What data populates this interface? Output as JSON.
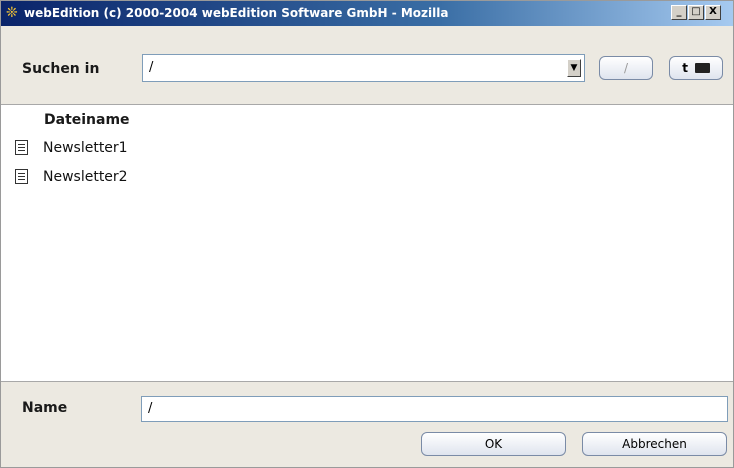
{
  "window": {
    "title": "webEdition (c) 2000-2004 webEdition Software GmbH - Mozilla",
    "app_icon": "webedition-icon",
    "controls": {
      "minimize": "_",
      "maximize": "□",
      "close": "X"
    }
  },
  "search": {
    "label": "Suchen in",
    "path_value": "/",
    "root_button_label": "/",
    "parent_folder_button_label": "t"
  },
  "filelist": {
    "column_header": "Dateiname",
    "files": [
      {
        "name": "Newsletter1",
        "icon": "document-icon"
      },
      {
        "name": "Newsletter2",
        "icon": "document-icon"
      }
    ]
  },
  "footer": {
    "name_label": "Name",
    "name_value": "/",
    "ok_label": "OK",
    "cancel_label": "Abbrechen"
  },
  "colors": {
    "titlebar_start": "#0a246a",
    "dialog_background": "#ece9e1",
    "input_border": "#7f9db9"
  }
}
